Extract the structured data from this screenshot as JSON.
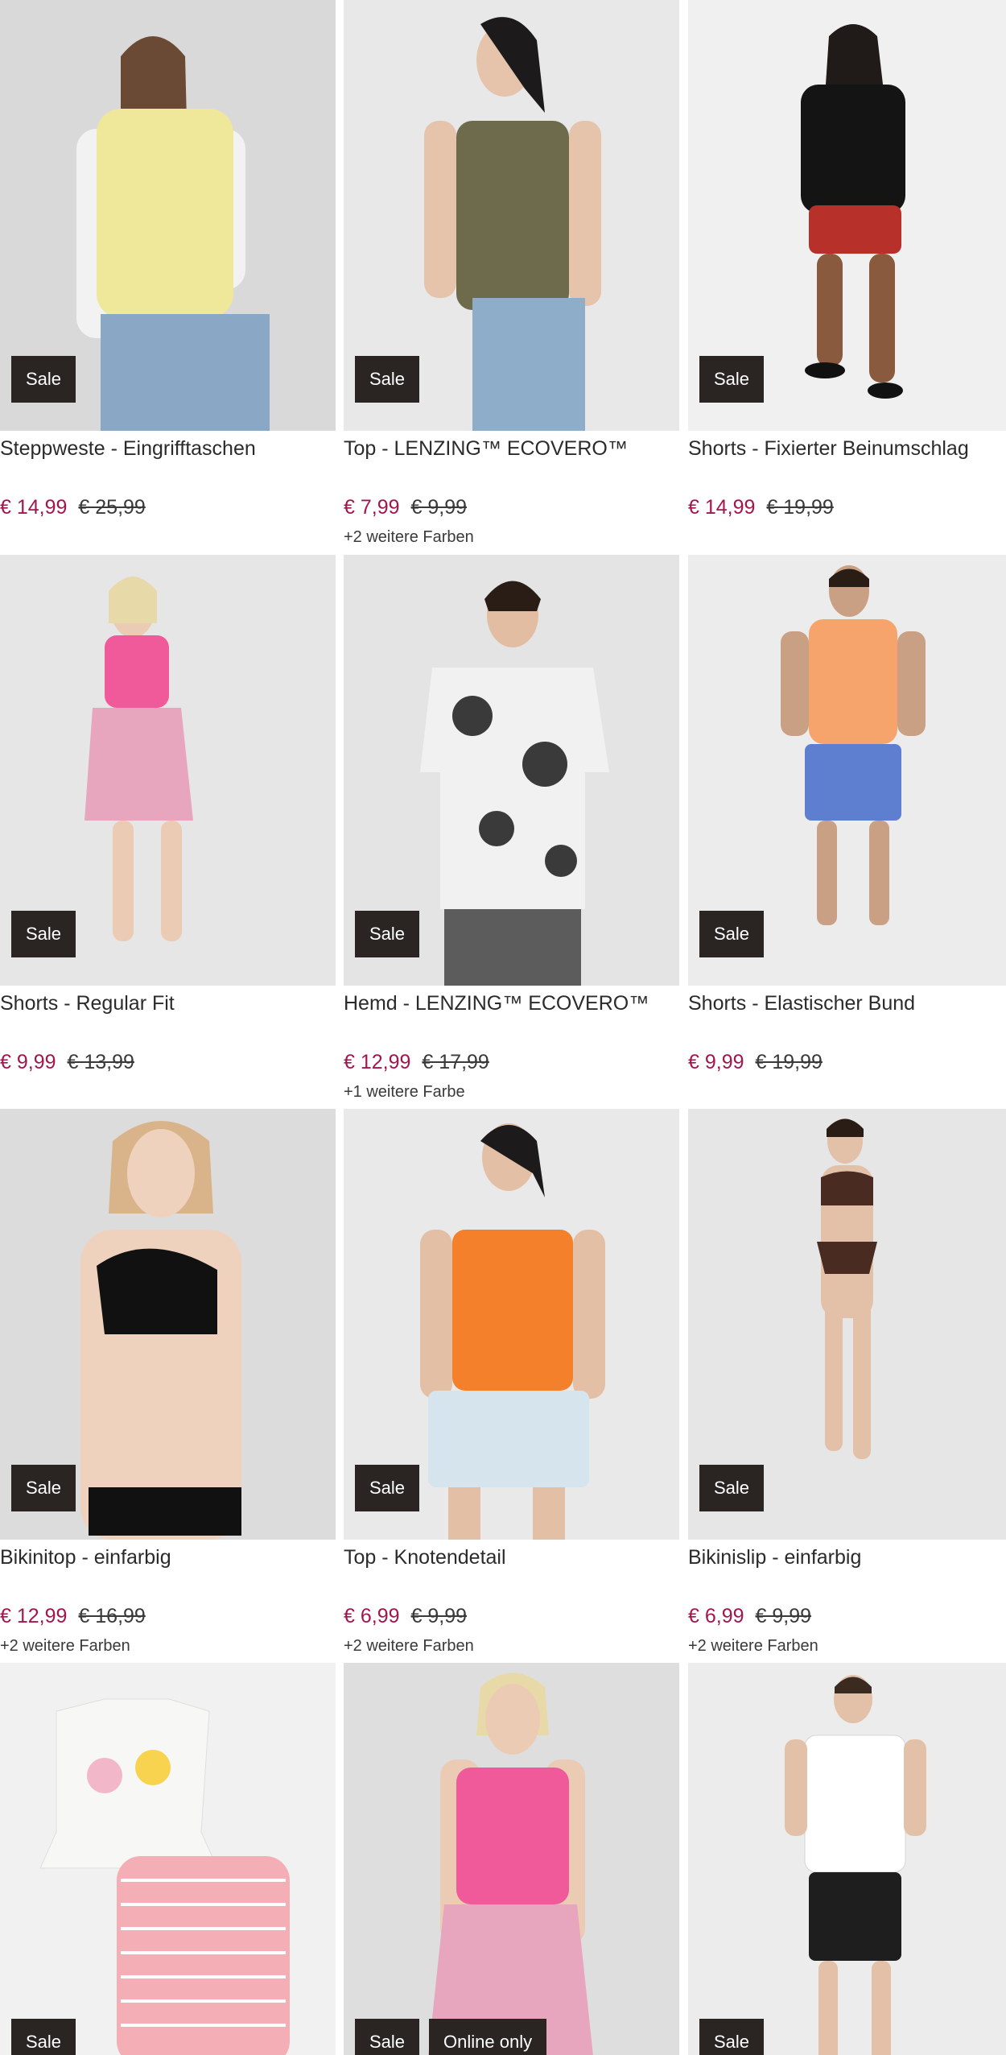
{
  "products": [
    {
      "title": "Steppweste - Eingrifftaschen",
      "badges": [
        "Sale"
      ],
      "price": "€ 14,99",
      "old_price": "€ 25,99",
      "colors": "",
      "image": "woman-yellow-puffer-vest"
    },
    {
      "title": "Top - LENZING™ ECOVERO™",
      "badges": [
        "Sale"
      ],
      "price": "€ 7,99",
      "old_price": "€ 9,99",
      "colors": "+2 weitere Farben",
      "image": "woman-olive-top"
    },
    {
      "title": "Shorts - Fixierter Beinumschlag",
      "badges": [
        "Sale"
      ],
      "price": "€ 14,99",
      "old_price": "€ 19,99",
      "colors": "",
      "image": "woman-red-shorts"
    },
    {
      "title": "Shorts - Regular Fit",
      "badges": [
        "Sale"
      ],
      "price": "€ 9,99",
      "old_price": "€ 13,99",
      "colors": "",
      "image": "woman-paisley-shorts"
    },
    {
      "title": "Hemd - LENZING™ ECOVERO™",
      "badges": [
        "Sale"
      ],
      "price": "€ 12,99",
      "old_price": "€ 17,99",
      "colors": "+1 weitere Farbe",
      "image": "man-floral-shirt"
    },
    {
      "title": "Shorts - Elastischer Bund",
      "badges": [
        "Sale"
      ],
      "price": "€ 9,99",
      "old_price": "€ 19,99",
      "colors": "",
      "image": "man-tie-dye-shorts"
    },
    {
      "title": "Bikinitop - einfarbig",
      "badges": [
        "Sale"
      ],
      "price": "€ 12,99",
      "old_price": "€ 16,99",
      "colors": "+2 weitere Farben",
      "image": "woman-black-bikini-top"
    },
    {
      "title": "Top - Knotendetail",
      "badges": [
        "Sale"
      ],
      "price": "€ 6,99",
      "old_price": "€ 9,99",
      "colors": "+2 weitere Farben",
      "image": "woman-orange-top"
    },
    {
      "title": "Bikinislip - einfarbig",
      "badges": [
        "Sale"
      ],
      "price": "€ 6,99",
      "old_price": "€ 9,99",
      "colors": "+2 weitere Farben",
      "image": "woman-brown-bikini"
    },
    {
      "title": "",
      "badges": [
        "Sale"
      ],
      "price": "",
      "old_price": "",
      "colors": "",
      "image": "kids-flamingo-set"
    },
    {
      "title": "",
      "badges": [
        "Sale",
        "Online only"
      ],
      "price": "",
      "old_price": "",
      "colors": "",
      "image": "woman-pink-halter-top"
    },
    {
      "title": "",
      "badges": [
        "Sale"
      ],
      "price": "",
      "old_price": "",
      "colors": "",
      "image": "man-white-tshirt"
    }
  ],
  "colors": {
    "sale_price": "#a3164d",
    "badge_bg": "#2a2423",
    "text": "#2b2b2b",
    "image_bg": "#ededed"
  }
}
